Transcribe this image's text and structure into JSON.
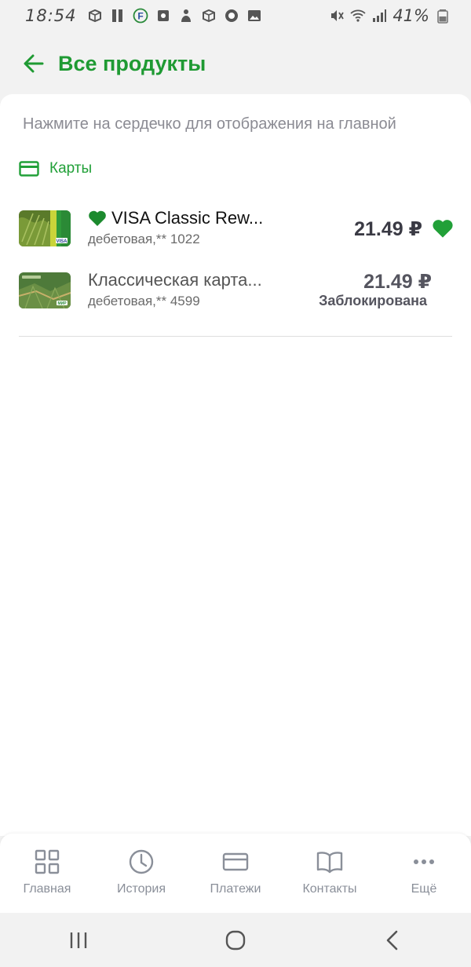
{
  "status_bar": {
    "time": "18:54",
    "battery": "41%"
  },
  "header": {
    "title": "Все продукты",
    "back_icon": "arrow-left-icon"
  },
  "hint": "Нажмите на сердечко для отображения на главной",
  "section": {
    "icon": "card-icon",
    "label": "Карты"
  },
  "products": [
    {
      "name": "VISA Classic Rew...",
      "subtitle": "дебетовая,** 1022",
      "amount": "21.49 ₽",
      "favorite": true
    },
    {
      "name": "Классическая карта...",
      "subtitle": "дебетовая,** 4599",
      "amount": "21.49 ₽",
      "status": "Заблокирована",
      "favorite": false
    }
  ],
  "bottom_nav": [
    {
      "label": "Главная",
      "icon": "grid-icon"
    },
    {
      "label": "История",
      "icon": "clock-icon"
    },
    {
      "label": "Платежи",
      "icon": "card-icon"
    },
    {
      "label": "Контакты",
      "icon": "book-icon"
    },
    {
      "label": "Ещё",
      "icon": "more-icon"
    }
  ],
  "colors": {
    "accent": "#21a038",
    "title_green": "#1f9a33",
    "muted": "#8a8f99"
  }
}
